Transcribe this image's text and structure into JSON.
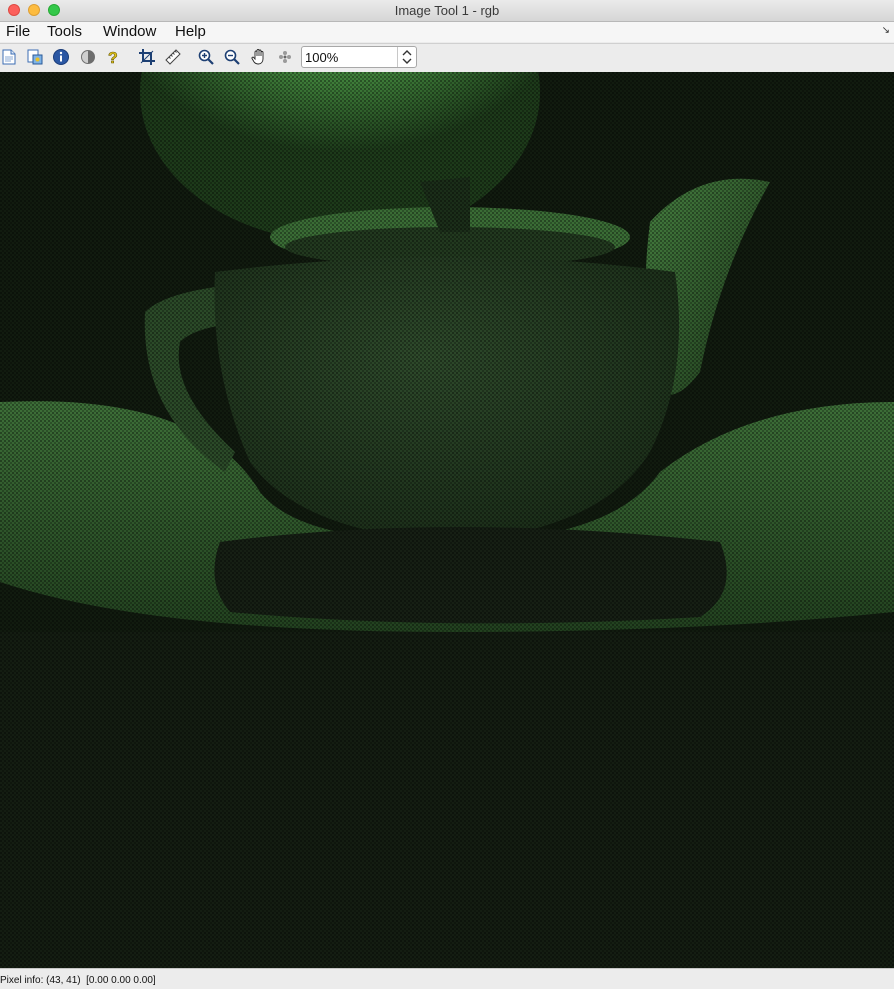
{
  "window": {
    "title": "Image Tool 1 - rgb"
  },
  "menubar": {
    "items": [
      "File",
      "Tools",
      "Window",
      "Help"
    ]
  },
  "toolbar": {
    "buttons": [
      {
        "icon": "new-document-icon"
      },
      {
        "icon": "image-properties-icon"
      },
      {
        "icon": "info-icon"
      },
      {
        "icon": "contrast-icon"
      },
      {
        "icon": "help-icon"
      },
      {
        "icon": "crop-icon"
      },
      {
        "icon": "ruler-icon"
      },
      {
        "icon": "zoom-in-icon"
      },
      {
        "icon": "zoom-out-icon"
      },
      {
        "icon": "hand-pan-icon"
      },
      {
        "icon": "move-icon"
      }
    ],
    "zoom_value": "100%"
  },
  "image": {
    "subject": "teapot on saucer, rendered in green channel",
    "tint": "#2e6a2a"
  },
  "status": {
    "pixel_info": "Pixel info: (43, 41)  [0.00 0.00 0.00]"
  }
}
